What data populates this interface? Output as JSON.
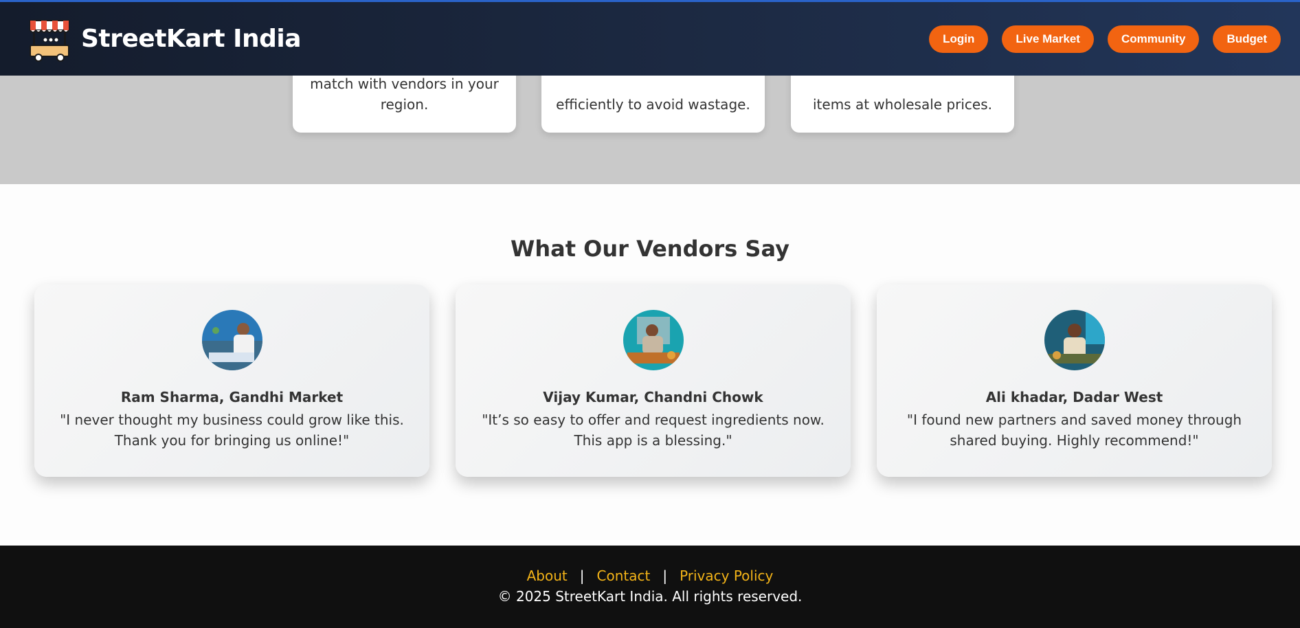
{
  "header": {
    "title": "StreetKart India",
    "nav": [
      "Login",
      "Live Market",
      "Community",
      "Budget"
    ]
  },
  "features": [
    "match with vendors in your region.",
    "efficiently to avoid wastage.",
    "items at wholesale prices."
  ],
  "testimonials": {
    "heading": "What Our Vendors Say",
    "items": [
      {
        "name": "Ram Sharma, Gandhi Market",
        "quote": "\"I never thought my business could grow like this. Thank you for bringing us online!\""
      },
      {
        "name": "Vijay Kumar, Chandni Chowk",
        "quote": "\"It’s so easy to offer and request ingredients now. This app is a blessing.\""
      },
      {
        "name": "Ali khadar, Dadar West",
        "quote": "\"I found new partners and saved money through shared buying. Highly recommend!\""
      }
    ]
  },
  "footer": {
    "links": [
      "About",
      "Contact",
      "Privacy Policy"
    ],
    "separator": "|",
    "copyright": "© 2025 StreetKart India. All rights reserved."
  },
  "colors": {
    "accent": "#f26411",
    "header_bg": "#1d2b45",
    "footer_link": "#f4b418",
    "footer_bg": "#101010"
  }
}
